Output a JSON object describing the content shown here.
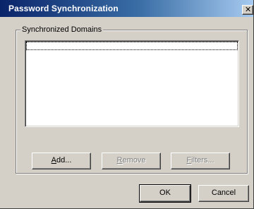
{
  "window": {
    "title": "Password Synchronization",
    "close_glyph": "✕"
  },
  "group": {
    "label": "Synchronized Domains"
  },
  "list": {
    "items": []
  },
  "buttons": {
    "add": {
      "mnemonic": "A",
      "rest": "dd...",
      "enabled": true
    },
    "remove": {
      "mnemonic": "R",
      "rest": "emove",
      "enabled": false
    },
    "filters": {
      "mnemonic": "F",
      "rest": "ilters...",
      "enabled": false
    },
    "ok": "OK",
    "cancel": "Cancel"
  },
  "colors": {
    "dialog_face": "#d4d0c8",
    "titlebar_start": "#0a246a",
    "titlebar_end": "#a6caf0"
  }
}
